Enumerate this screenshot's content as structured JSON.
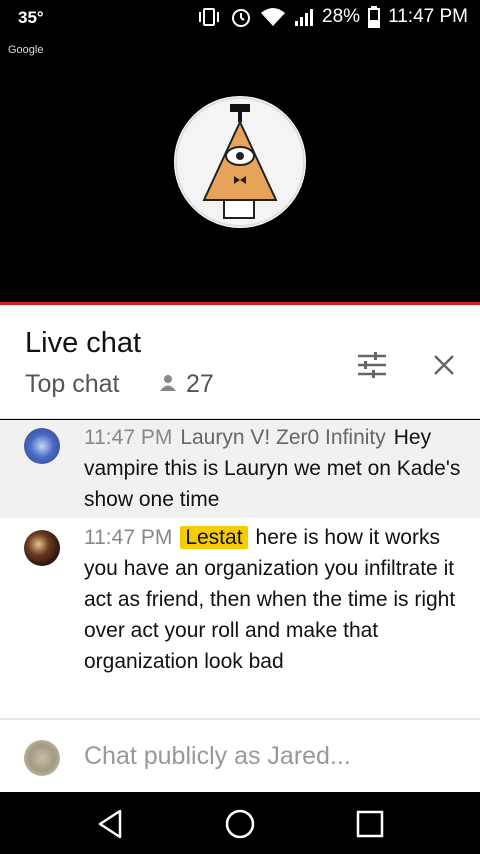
{
  "status_bar": {
    "temperature": "35°",
    "battery": "28%",
    "time": "11:47 PM",
    "icons": [
      "vibrate-icon",
      "alarm-icon",
      "wifi-icon",
      "signal-icon",
      "battery-icon"
    ]
  },
  "video": {
    "overlay_label": "Google"
  },
  "chat_header": {
    "title": "Live chat",
    "mode": "Top chat",
    "viewer_count": "27"
  },
  "messages": [
    {
      "time": "11:47 PM",
      "author": "Lauryn V! Zer0 Infinity",
      "text": "Hey vampire this is Lauryn we met on Kade's show one time",
      "highlighted": true
    },
    {
      "time": "11:47 PM",
      "author": "Lestat",
      "text": "here is how it works you have an organization you infiltrate it act as friend, then when the time is right over act your roll and make that organization look bad",
      "owner": true
    }
  ],
  "input": {
    "placeholder": "Chat publicly as Jared..."
  },
  "colors": {
    "progress_red": "#d81f26",
    "owner_badge": "#f5cc00"
  }
}
